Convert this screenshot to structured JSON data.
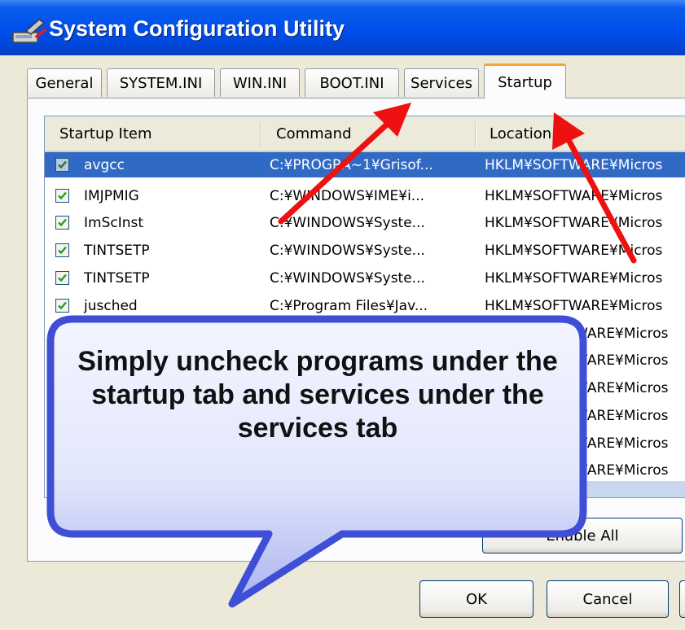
{
  "window": {
    "title": "System Configuration Utility"
  },
  "tabs": [
    {
      "label": "General",
      "active": false
    },
    {
      "label": "SYSTEM.INI",
      "active": false
    },
    {
      "label": "WIN.INI",
      "active": false
    },
    {
      "label": "BOOT.INI",
      "active": false
    },
    {
      "label": "Services",
      "active": false
    },
    {
      "label": "Startup",
      "active": true
    }
  ],
  "startup_list": {
    "columns": [
      "Startup Item",
      "Command",
      "Location"
    ],
    "rows": [
      {
        "checked": true,
        "selected": true,
        "item": "avgcc",
        "command": "C:¥PROGRA~1¥Grisof...",
        "location": "HKLM¥SOFTWARE¥Micros"
      },
      {
        "checked": true,
        "selected": false,
        "item": "IMJPMIG",
        "command": "C:¥WINDOWS¥IME¥i...",
        "location": "HKLM¥SOFTWARE¥Micros"
      },
      {
        "checked": true,
        "selected": false,
        "item": "ImScInst",
        "command": "C:¥WINDOWS¥Syste...",
        "location": "HKLM¥SOFTWARE¥Micros"
      },
      {
        "checked": true,
        "selected": false,
        "item": "TINTSETP",
        "command": "C:¥WINDOWS¥Syste...",
        "location": "HKLM¥SOFTWARE¥Micros"
      },
      {
        "checked": true,
        "selected": false,
        "item": "TINTSETP",
        "command": "C:¥WINDOWS¥Syste...",
        "location": "HKLM¥SOFTWARE¥Micros"
      },
      {
        "checked": true,
        "selected": false,
        "item": "jusched",
        "command": "C:¥Program Files¥Jav...",
        "location": "HKLM¥SOFTWARE¥Micros"
      }
    ],
    "obscured_locations": [
      "WARE¥Micros",
      "WARE¥Micros",
      "WARE¥Micros",
      "WARE¥Micros",
      "WARE¥Micros",
      "WARE¥Micros"
    ]
  },
  "buttons": {
    "enable_all": "Enable All",
    "ok": "OK",
    "cancel": "Cancel"
  },
  "annotation": {
    "callout_text": "Simply uncheck programs under the startup tab and services under the services tab",
    "callout_color": "#3e4fd6",
    "arrow_color": "#ee1111"
  },
  "colors": {
    "titlebar": "#0050ee",
    "selection": "#316ac5",
    "active_tab_accent": "#f9a339"
  }
}
